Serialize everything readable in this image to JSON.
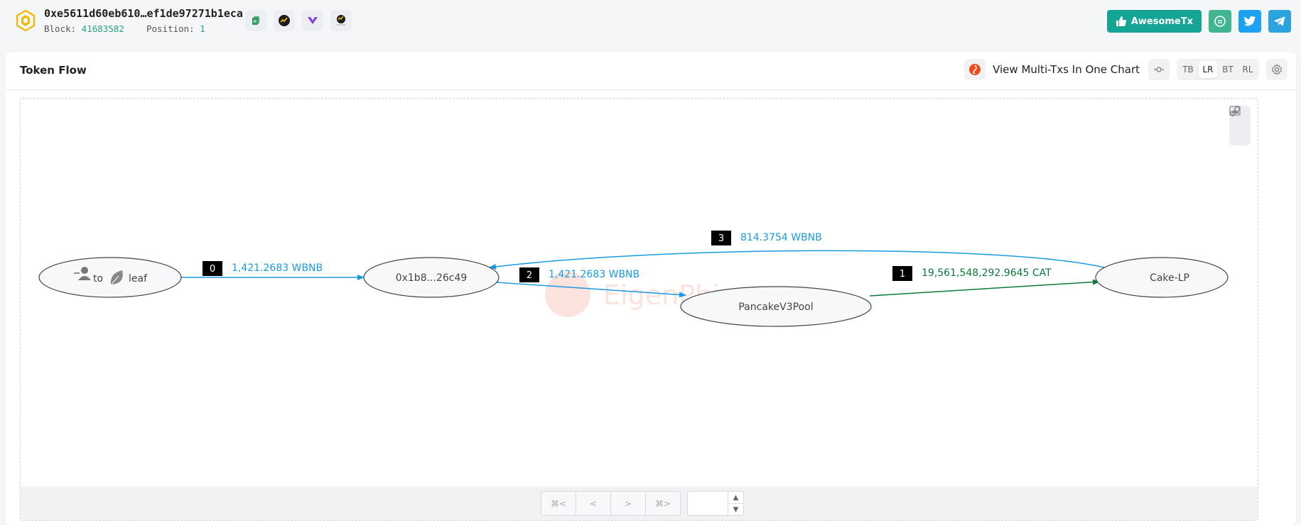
{
  "header": {
    "tx_hash": "0xe5611d60eb610…ef1de97271b1eca",
    "block_label": "Block:",
    "block_value": "41683582",
    "position_label": "Position:",
    "position_value": "1",
    "tool_icons": [
      "copy-icon",
      "explorer-icon",
      "phalcon-icon",
      "openchain-icon"
    ],
    "awesome_label": "AwesomeTx",
    "social": [
      "comment-icon",
      "twitter-icon",
      "telegram-icon"
    ],
    "colors": {
      "accent": "#14a594",
      "twitter": "#1da1f2",
      "telegram": "#2aa3df"
    }
  },
  "card": {
    "title": "Token Flow",
    "multi_tx_label": "View Multi-Txs In One Chart",
    "layout_options": [
      "TB",
      "LR",
      "BT",
      "RL"
    ],
    "layout_selected": "LR"
  },
  "graph": {
    "watermark": "EigenPhi",
    "nodes": {
      "origin": {
        "to": "to",
        "leaf": "leaf"
      },
      "n1": "0x1b8...26c49",
      "n2": "PancakeV3Pool",
      "n3": "Cake-LP"
    },
    "edges": [
      {
        "index": "0",
        "amount": "1,421.2683 WBNB",
        "color": "#1a9ae0"
      },
      {
        "index": "1",
        "amount": "19,561,548,292.9645 CAT",
        "color": "#0b7a3b"
      },
      {
        "index": "2",
        "amount": "1,421.2683 WBNB",
        "color": "#1a9ae0"
      },
      {
        "index": "3",
        "amount": "814.3754 WBNB",
        "color": "#1a9ae0"
      }
    ]
  },
  "pager": {
    "first": "⌘<",
    "prev": "<",
    "next": ">",
    "last": "⌘>",
    "page_value": ""
  }
}
